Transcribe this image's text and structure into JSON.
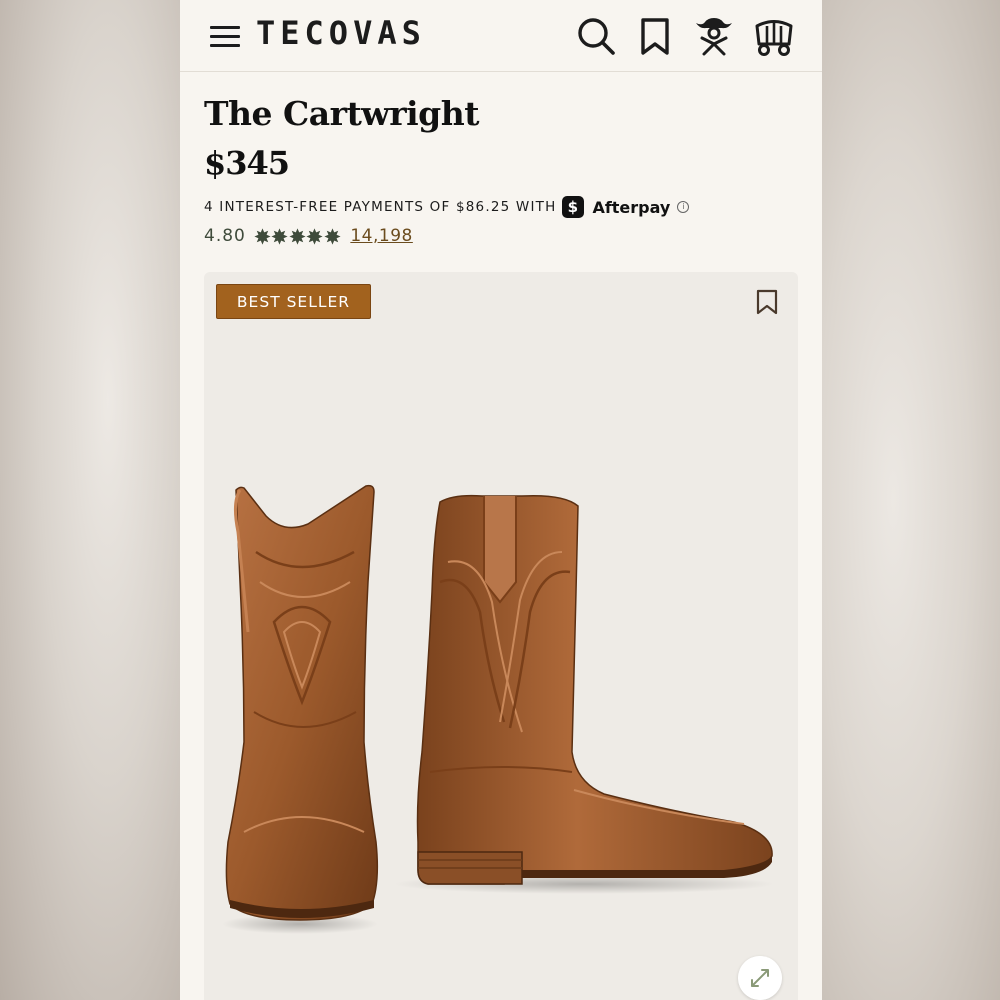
{
  "header": {
    "brand": "TECOVAS",
    "icons": [
      "hamburger-menu-icon",
      "search-icon",
      "bookmark-icon",
      "account-icon",
      "cart-wagon-icon"
    ]
  },
  "product": {
    "title": "The Cartwright",
    "price": "$345",
    "payments_text": "4 INTEREST-FREE PAYMENTS OF $86.25 WITH",
    "afterpay_badge": "$",
    "afterpay_label": "Afterpay",
    "info_glyph": "i",
    "rating": "4.80",
    "stars": 5,
    "review_count": "14,198"
  },
  "gallery": {
    "badge": "BEST SELLER",
    "icons": [
      "bookmark-icon",
      "expand-icon"
    ]
  },
  "colors": {
    "background": "#f8f5f0",
    "star": "#3f4b3b",
    "badge": "#a2621e",
    "link": "#6b4c1e",
    "leather": "#9c5a2c"
  }
}
